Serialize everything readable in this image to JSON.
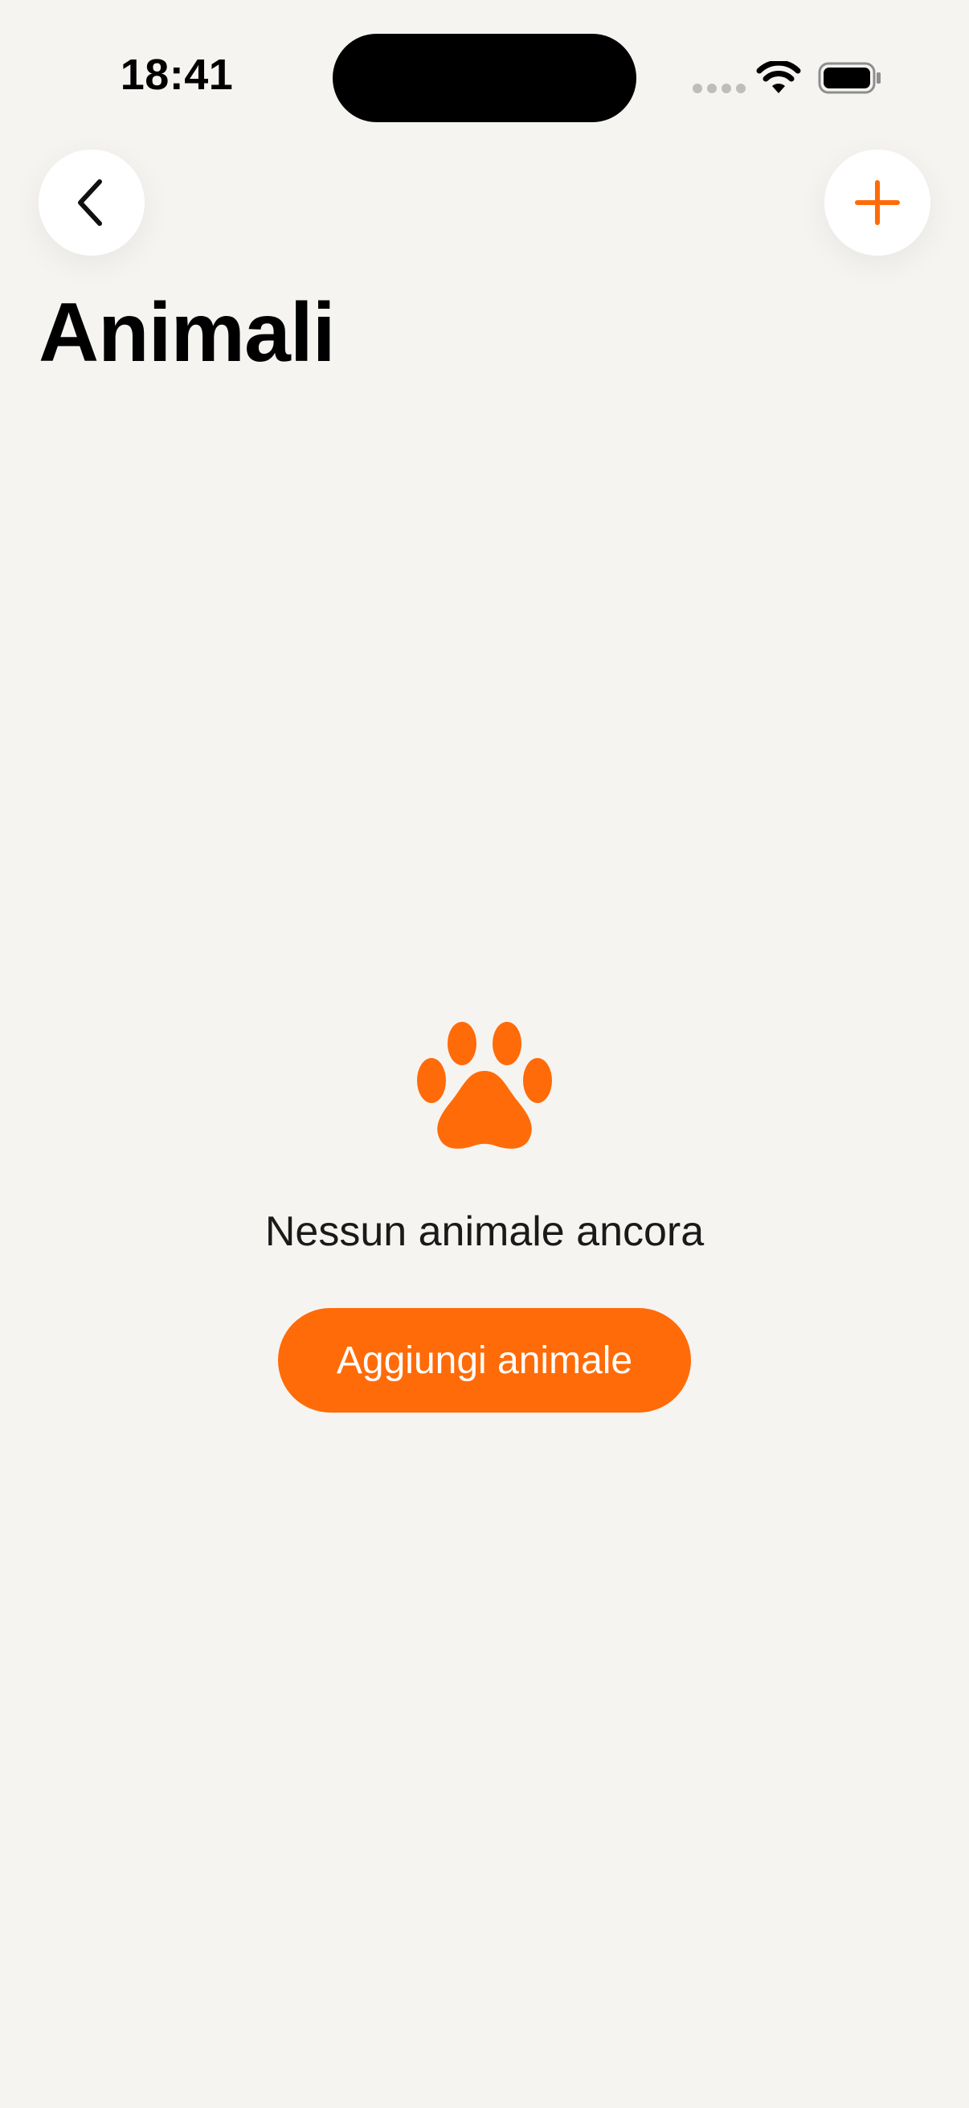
{
  "status_bar": {
    "time": "18:41"
  },
  "nav": {
    "back_icon": "chevron-left-icon",
    "add_icon": "plus-icon"
  },
  "page": {
    "title": "Animali"
  },
  "empty_state": {
    "icon": "paw-icon",
    "message": "Nessun animale ancora",
    "button_label": "Aggiungi animale"
  },
  "colors": {
    "background": "#F6F4F1",
    "accent": "#FF6B08",
    "button_bg": "#FFFFFF",
    "text": "#111111"
  }
}
